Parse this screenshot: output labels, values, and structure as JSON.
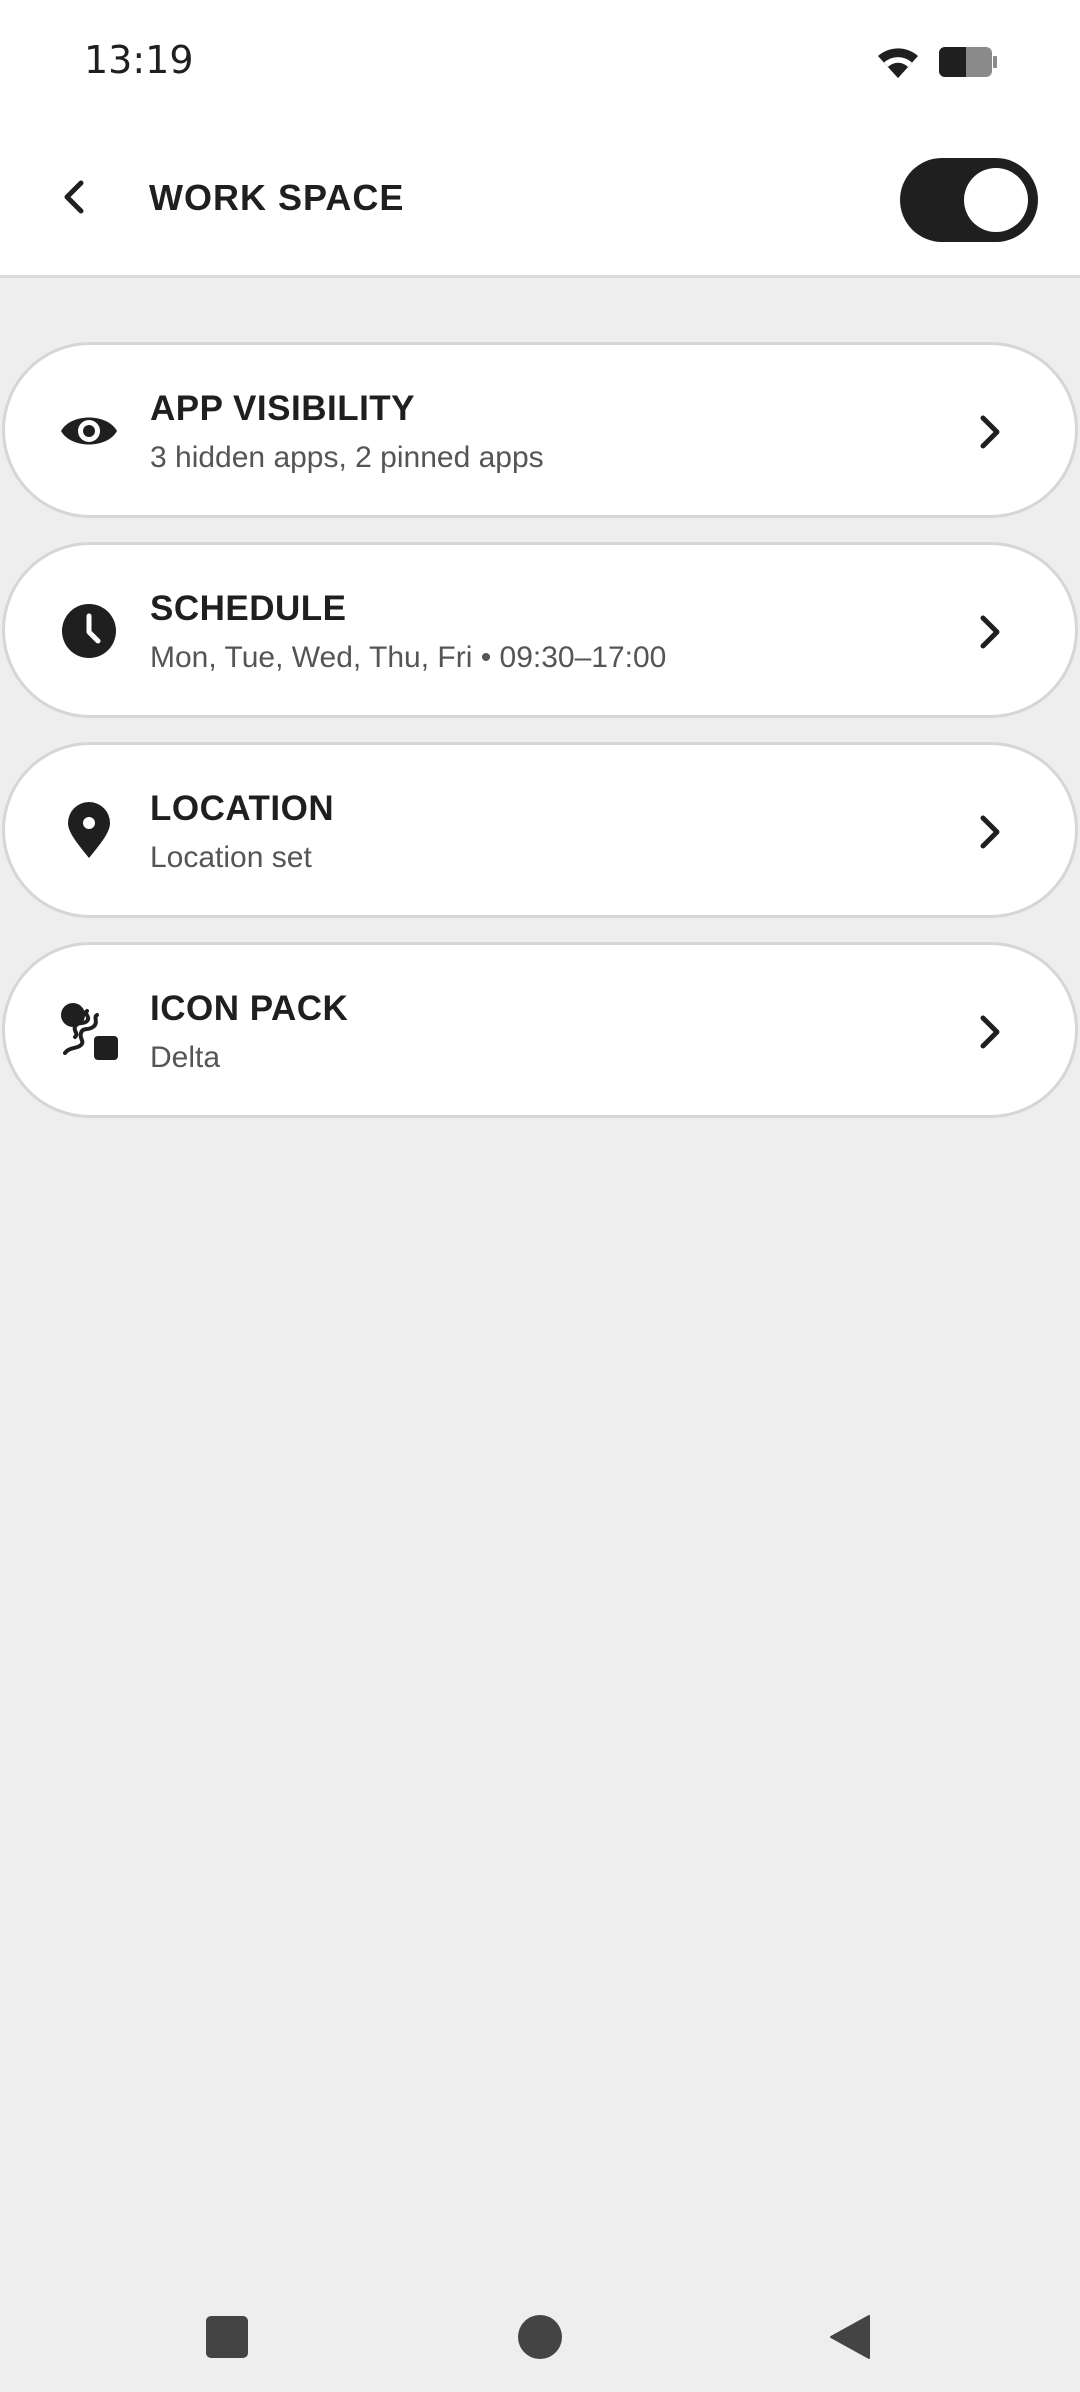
{
  "status_bar": {
    "time": "13:19",
    "wifi_icon": "wifi-icon",
    "battery_icon": "battery-icon"
  },
  "app_bar": {
    "title": "WORK SPACE",
    "back_icon": "chevron-left-icon",
    "toggle_on": true
  },
  "settings": [
    {
      "title": "APP VISIBILITY",
      "subtitle": "3 hidden apps, 2 pinned apps",
      "icon": "eye-icon"
    },
    {
      "title": "SCHEDULE",
      "subtitle": "Mon, Tue, Wed, Thu, Fri • 09:30–17:00",
      "icon": "clock-icon"
    },
    {
      "title": "LOCATION",
      "subtitle": "Location set",
      "icon": "location-pin-icon"
    },
    {
      "title": "ICON PACK",
      "subtitle": "Delta",
      "icon": "icon-pack-icon"
    }
  ],
  "nav_bar": {
    "recents_icon": "square-icon",
    "home_icon": "circle-icon",
    "back_icon": "triangle-back-icon"
  },
  "colors": {
    "background": "#eeeeee",
    "surface": "#ffffff",
    "primary_text": "#1f1f1f",
    "secondary_text": "#555555",
    "toggle_track": "#1f1f1f",
    "card_border": "#d6d6d6"
  }
}
